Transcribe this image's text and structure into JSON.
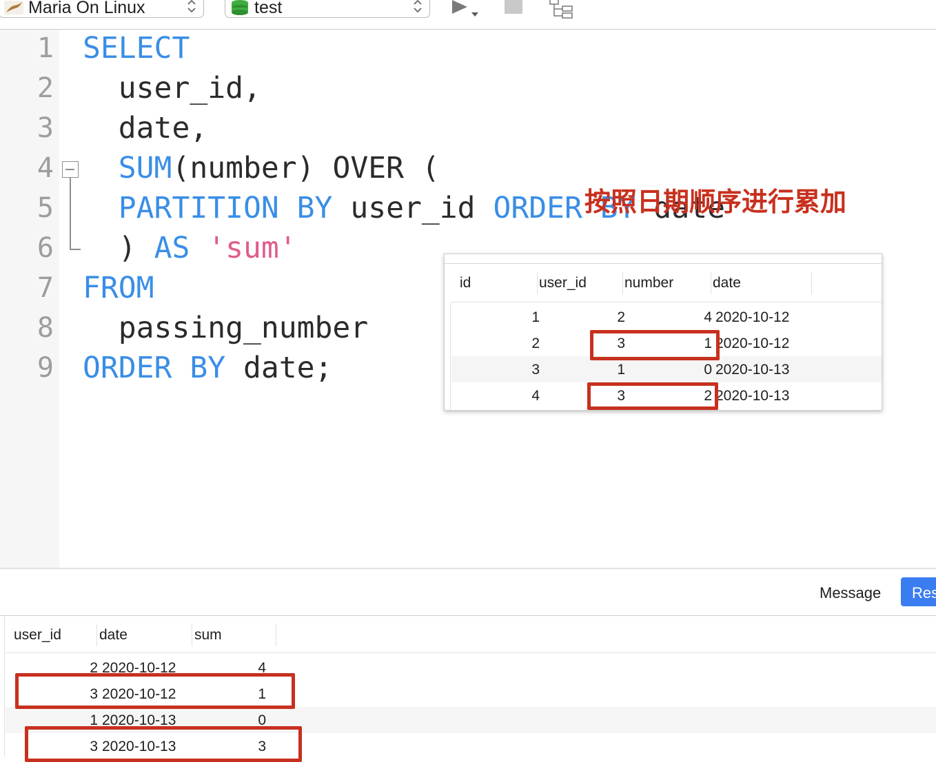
{
  "toolbar": {
    "connection": "Maria On Linux",
    "database": "test"
  },
  "editor": {
    "line_numbers": [
      "1",
      "2",
      "3",
      "4",
      "5",
      "6",
      "7",
      "8",
      "9"
    ],
    "lines": [
      [
        {
          "t": "SELECT",
          "c": "kw"
        }
      ],
      [
        {
          "t": "  user_id,",
          "c": ""
        }
      ],
      [
        {
          "t": "  date,",
          "c": ""
        }
      ],
      [
        {
          "t": "  SUM",
          "c": "kw"
        },
        {
          "t": "(number) OVER (",
          "c": ""
        }
      ],
      [
        {
          "t": "  PARTITION BY",
          "c": "kw"
        },
        {
          "t": " user_id ",
          "c": ""
        },
        {
          "t": "ORDER BY",
          "c": "kw"
        },
        {
          "t": " date",
          "c": ""
        }
      ],
      [
        {
          "t": "  ) ",
          "c": ""
        },
        {
          "t": "AS",
          "c": "kw"
        },
        {
          "t": " ",
          "c": ""
        },
        {
          "t": "'sum'",
          "c": "str"
        }
      ],
      [
        {
          "t": "FROM",
          "c": "kw"
        }
      ],
      [
        {
          "t": "  passing_number",
          "c": ""
        }
      ],
      [
        {
          "t": "ORDER BY",
          "c": "kw"
        },
        {
          "t": " date;",
          "c": ""
        }
      ]
    ],
    "annotation": "按照日期顺序进行累加"
  },
  "source_table": {
    "columns": [
      "id",
      "user_id",
      "number",
      "date"
    ],
    "rows": [
      [
        "1",
        "2",
        "4",
        "2020-10-12"
      ],
      [
        "2",
        "3",
        "1",
        "2020-10-12"
      ],
      [
        "3",
        "1",
        "0",
        "2020-10-13"
      ],
      [
        "4",
        "3",
        "2",
        "2020-10-13"
      ]
    ]
  },
  "result_panel": {
    "tabs": [
      "Message",
      "Res"
    ],
    "columns": [
      "user_id",
      "date",
      "sum"
    ],
    "rows": [
      [
        "2",
        "2020-10-12",
        "4"
      ],
      [
        "3",
        "2020-10-12",
        "1"
      ],
      [
        "1",
        "2020-10-13",
        "0"
      ],
      [
        "3",
        "2020-10-13",
        "3"
      ]
    ]
  },
  "colors": {
    "keyword": "#3a8ee6",
    "string": "#e05c8c",
    "highlight": "#c8301e",
    "active_tab": "#3a7df0"
  },
  "icons": [
    "mariadb-logo-icon",
    "database-stack-icon",
    "run-icon",
    "stop-icon",
    "explain-icon",
    "updown-arrows-icon"
  ]
}
